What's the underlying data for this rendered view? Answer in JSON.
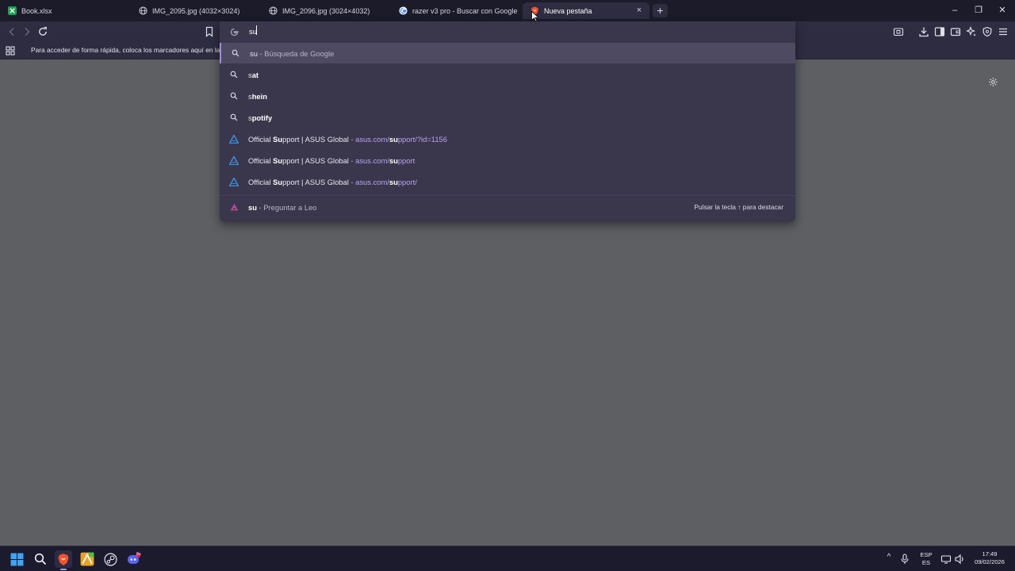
{
  "tabs": [
    {
      "title": "Book.xlsx",
      "icon": "excel-icon",
      "active": false
    },
    {
      "title": "IMG_2095.jpg (4032×3024)",
      "icon": "globe-icon",
      "active": false
    },
    {
      "title": "IMG_2096.jpg (3024×4032)",
      "icon": "globe-icon",
      "active": false
    },
    {
      "title": "razer v3 pro - Buscar con Google",
      "icon": "google-icon",
      "active": false
    },
    {
      "title": "Nueva pestaña",
      "icon": "brave-icon",
      "active": true
    }
  ],
  "tab_close_glyph": "×",
  "new_tab_glyph": "+",
  "window_controls": {
    "minimize": "–",
    "maximize": "❐",
    "close": "✕"
  },
  "bookmarks_bar": {
    "hint": "Para acceder de forma rápida, coloca los marcadores aquí en la barra de marcadores"
  },
  "omnibox": {
    "value": "su",
    "suggestions": [
      {
        "prefix": "su",
        "bold": "",
        "sub": " - Búsqueda de Google",
        "url": "",
        "icon": "search-icon"
      },
      {
        "prefix": "s",
        "bold": "at",
        "sub": "",
        "url": "",
        "icon": "search-icon"
      },
      {
        "prefix": "s",
        "bold": "hein",
        "sub": "",
        "url": "",
        "icon": "search-icon"
      },
      {
        "prefix": "s",
        "bold": "potify",
        "sub": "",
        "url": "",
        "icon": "search-icon"
      },
      {
        "pre": "Official ",
        "bold": "Su",
        "post": "pport | ASUS Global",
        "dash": " - ",
        "url_pre": "asus.com/",
        "url_bold": "su",
        "url_post": "pport/?id=1156",
        "icon": "asus-icon"
      },
      {
        "pre": "Official ",
        "bold": "Su",
        "post": "pport | ASUS Global",
        "dash": " - ",
        "url_pre": "asus.com/",
        "url_bold": "su",
        "url_post": "pport",
        "icon": "asus-icon"
      },
      {
        "pre": "Official ",
        "bold": "Su",
        "post": "pport | ASUS Global",
        "dash": " - ",
        "url_pre": "asus.com/",
        "url_bold": "su",
        "url_post": "pport/",
        "icon": "asus-icon"
      }
    ],
    "leo": {
      "bold": "su",
      "text": " - Preguntar a Leo",
      "hint": "Pulsar la tecla ↑ para destacar",
      "icon": "leo-icon"
    }
  },
  "taskbar": {
    "tray": {
      "lang_top": "ESP",
      "lang_bottom": "ES",
      "time": "17:49",
      "date": "09/02/2026"
    },
    "discord_badge": "9+",
    "chevron": "^"
  },
  "colors": {
    "accent": "#9b8bd8",
    "url": "#b9a4f0",
    "background": "#5e5f63"
  }
}
